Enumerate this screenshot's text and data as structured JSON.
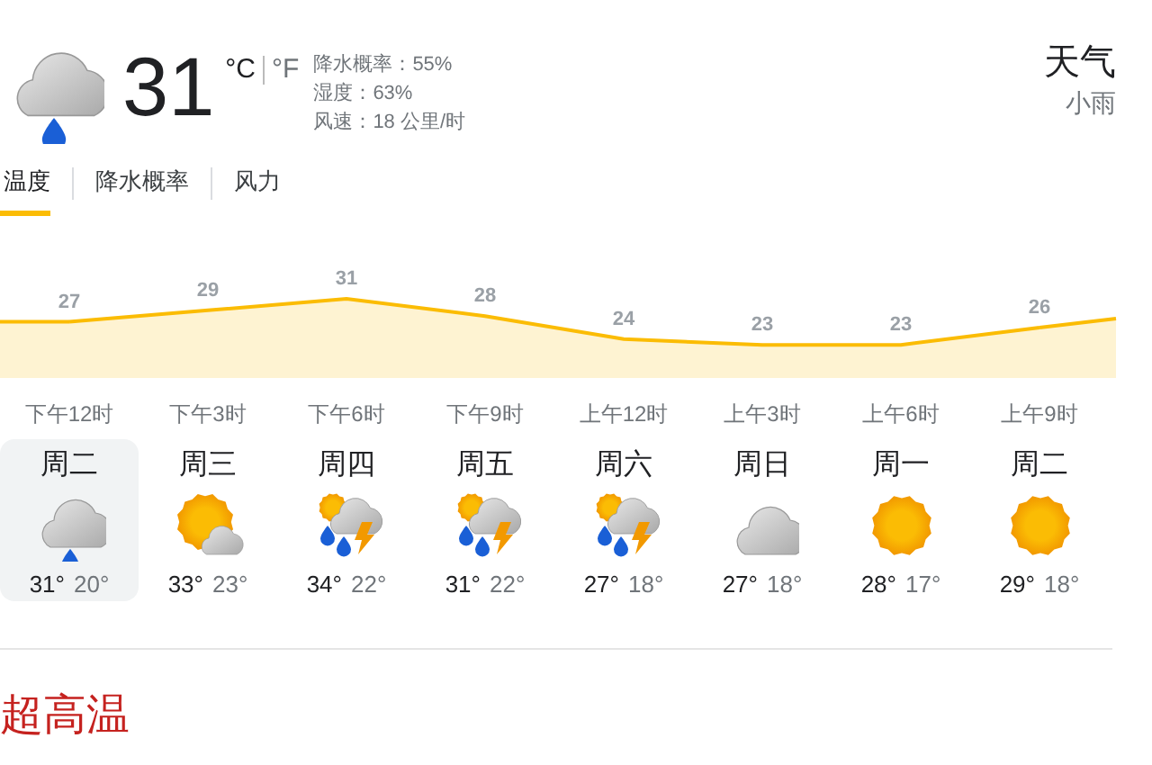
{
  "current": {
    "kind": "rain",
    "temp": "31",
    "units": [
      {
        "label": "°C",
        "selected": true
      },
      {
        "label": "°F",
        "selected": false
      }
    ],
    "details": [
      "降水概率：55%",
      "湿度：63%",
      "风速：18 公里/时"
    ]
  },
  "title": "天气",
  "condition": "小雨",
  "tabs": [
    {
      "label": "温度",
      "selected": true
    },
    {
      "label": "降水概率",
      "selected": false
    },
    {
      "label": "风力",
      "selected": false
    }
  ],
  "chart_data": {
    "type": "area",
    "categories": [
      "下午12时",
      "下午3时",
      "下午6时",
      "下午9时",
      "上午12时",
      "上午3时",
      "上午6时",
      "上午9时"
    ],
    "series": [
      {
        "color": "#fbbc04",
        "values": [
          27,
          29,
          31,
          28,
          24,
          23,
          23,
          26
        ]
      }
    ],
    "data_labels": true
  },
  "days": [
    {
      "day": "周二",
      "kind": "rain",
      "high": "31°",
      "low": "20°",
      "selected": true
    },
    {
      "day": "周三",
      "kind": "sun-cloud",
      "high": "33°",
      "low": "23°",
      "selected": false
    },
    {
      "day": "周四",
      "kind": "storm",
      "high": "34°",
      "low": "22°",
      "selected": false
    },
    {
      "day": "周五",
      "kind": "storm",
      "high": "31°",
      "low": "22°",
      "selected": false
    },
    {
      "day": "周六",
      "kind": "storm",
      "high": "27°",
      "low": "18°",
      "selected": false
    },
    {
      "day": "周日",
      "kind": "cloud",
      "high": "27°",
      "low": "18°",
      "selected": false
    },
    {
      "day": "周一",
      "kind": "sun",
      "high": "28°",
      "low": "17°",
      "selected": false
    },
    {
      "day": "周二",
      "kind": "sun",
      "high": "29°",
      "low": "18°",
      "selected": false
    }
  ],
  "alert": "超高温"
}
